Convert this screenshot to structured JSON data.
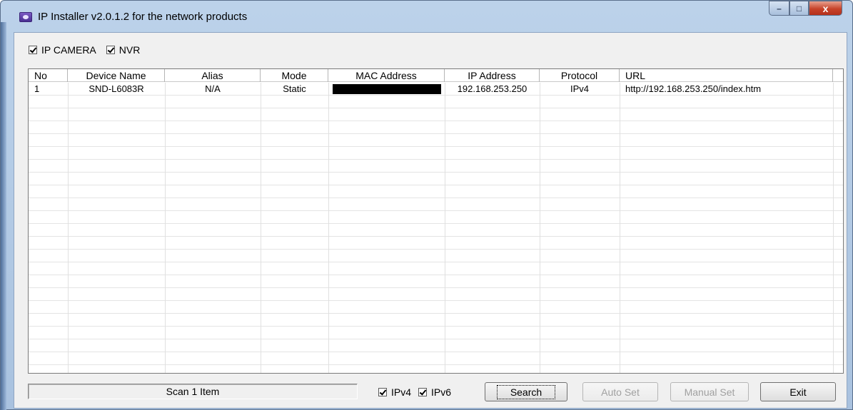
{
  "window": {
    "title": "IP Installer v2.0.1.2 for the network products",
    "icon": "eye-app-icon",
    "controls": {
      "minimize": "–",
      "maximize": "□",
      "close": "x"
    }
  },
  "filters": [
    {
      "label": "IP CAMERA",
      "checked": true
    },
    {
      "label": "NVR",
      "checked": true
    }
  ],
  "table": {
    "columns": [
      "No",
      "Device Name",
      "Alias",
      "Mode",
      "MAC Address",
      "IP Address",
      "Protocol",
      "URL"
    ],
    "rows": [
      {
        "no": "1",
        "device_name": "SND-L6083R",
        "alias": "N/A",
        "mode": "Static",
        "mac_address": "",
        "ip_address": "192.168.253.250",
        "protocol": "IPv4",
        "url": "http://192.168.253.250/index.htm"
      }
    ]
  },
  "status": {
    "text": "Scan 1 Item"
  },
  "protocols": [
    {
      "label": "IPv4",
      "checked": true
    },
    {
      "label": "IPv6",
      "checked": true
    }
  ],
  "buttons": {
    "search": "Search",
    "auto_set": "Auto Set",
    "manual_set": "Manual Set",
    "exit": "Exit"
  }
}
